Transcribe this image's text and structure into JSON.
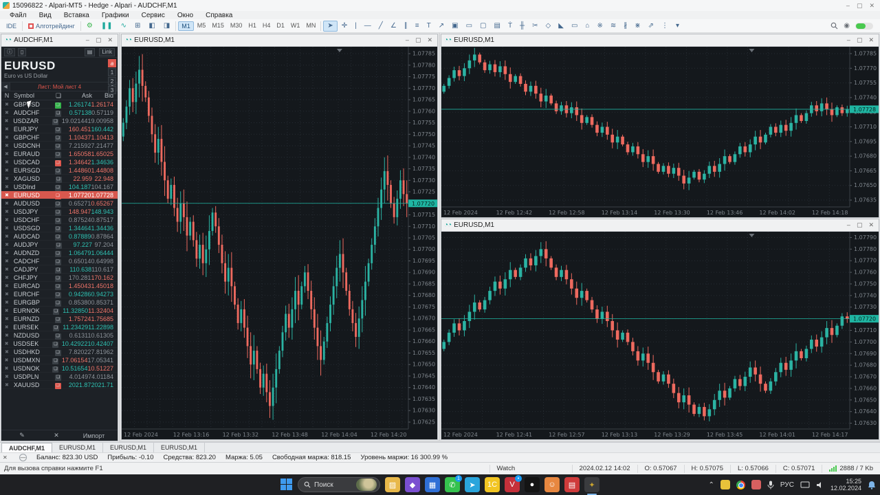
{
  "colors": {
    "candle_up": "#2bb3a3",
    "candle_down": "#ee6a5f",
    "price_tag_bg": "#1fb5a2",
    "selected_row": "#d8584e",
    "chart_bg": "#14181c",
    "grid": "#262c33",
    "axis_text": "#7f868d"
  },
  "app": {
    "title": "15096822 - Alpari-MT5 - Hedge - Alpari - AUDCHF,M1",
    "menus": [
      "Файл",
      "Вид",
      "Вставка",
      "Графики",
      "Сервис",
      "Окно",
      "Справка"
    ],
    "window_buttons": [
      "–",
      "▢",
      "✕"
    ]
  },
  "toolbar": {
    "ide_label": "IDE",
    "algo_label": "Алготрейдинг",
    "left_icons": [
      {
        "name": "gear-icon",
        "glyph": "⚙",
        "color": "#35b44a"
      },
      {
        "name": "pause-tester-icon",
        "glyph": "❚❚",
        "color": "#1fa99d"
      },
      {
        "name": "zigzag-icon",
        "glyph": "∿",
        "color": "#1fa99d"
      },
      {
        "name": "grid-window-icon",
        "glyph": "⊞",
        "color": "#44688e"
      },
      {
        "name": "expand-horizontal-icon",
        "glyph": "◧",
        "color": "#44688e"
      },
      {
        "name": "collapse-horizontal-icon",
        "glyph": "◨",
        "color": "#44688e"
      }
    ],
    "timeframes": [
      {
        "label": "M1",
        "active": true
      },
      {
        "label": "M5",
        "active": false
      },
      {
        "label": "M15",
        "active": false
      },
      {
        "label": "M30",
        "active": false
      },
      {
        "label": "H1",
        "active": false
      },
      {
        "label": "H4",
        "active": false
      },
      {
        "label": "D1",
        "active": false
      },
      {
        "label": "W1",
        "active": false
      },
      {
        "label": "MN",
        "active": false
      }
    ],
    "draw_icons": [
      {
        "name": "cursor-icon",
        "glyph": "➤",
        "active": true
      },
      {
        "name": "crosshair-icon",
        "glyph": "✛",
        "active": false
      },
      {
        "name": "vertical-line-icon",
        "glyph": "|",
        "active": false
      },
      {
        "name": "horizontal-line-icon",
        "glyph": "―",
        "active": false
      },
      {
        "name": "trendline-icon",
        "glyph": "╱",
        "active": false
      },
      {
        "name": "trend-angle-icon",
        "glyph": "∠",
        "active": false
      },
      {
        "name": "channel-icon",
        "glyph": "∥",
        "active": false
      },
      {
        "name": "equidistant-channel-icon",
        "glyph": "≡",
        "active": false
      },
      {
        "name": "text-label-icon",
        "glyph": "T",
        "active": false
      },
      {
        "name": "arrow-icon",
        "glyph": "↗",
        "active": false
      },
      {
        "name": "chart-object-icon",
        "glyph": "▣",
        "active": false
      },
      {
        "name": "label-object-icon",
        "glyph": "▭",
        "active": false
      },
      {
        "name": "button-object-icon",
        "glyph": "▢",
        "active": false
      },
      {
        "name": "image-object-icon",
        "glyph": "▤",
        "active": false
      },
      {
        "name": "styles-icon",
        "glyph": "Ṫ",
        "active": false
      },
      {
        "name": "volumes-icon",
        "glyph": "╫",
        "active": false
      },
      {
        "name": "scissors-icon",
        "glyph": "✂",
        "active": false
      },
      {
        "name": "ellipse-icon",
        "glyph": "◇",
        "active": false
      },
      {
        "name": "triangle-icon",
        "glyph": "◣",
        "active": false
      },
      {
        "name": "rectangle-icon",
        "glyph": "▭",
        "active": false
      },
      {
        "name": "shapes-icon",
        "glyph": "⌂",
        "active": false
      },
      {
        "name": "fibo-fan-icon",
        "glyph": "※",
        "active": false
      },
      {
        "name": "fibo-arcs-icon",
        "glyph": "≋",
        "active": false
      },
      {
        "name": "fibo-channel-icon",
        "glyph": "∦",
        "active": false
      },
      {
        "name": "gann-icon",
        "glyph": "⋇",
        "active": false
      },
      {
        "name": "andrews-pitchfork-icon",
        "glyph": "⇗",
        "active": false
      },
      {
        "name": "cycles-icon",
        "glyph": "⋮",
        "active": false
      },
      {
        "name": "objects-list-icon",
        "glyph": "▾",
        "active": false
      }
    ]
  },
  "market_watch": {
    "window_title": "AUDCHF,M1",
    "tools": {
      "info": "ⓘ",
      "mobile": "▯",
      "pin": "▤",
      "link_label": "Link"
    },
    "symbol_name": "EURUSD",
    "symbol_desc": "Euro vs US Dollar",
    "depth_buttons": [
      "a",
      "1",
      "2",
      "3"
    ],
    "sheet_label": "Лист: Мой лист 4",
    "columns": {
      "n": "N",
      "symbol": "Symbol",
      "chart": "❏",
      "ask": "Ask",
      "bid": "Bid"
    },
    "footer": {
      "edit": "✎",
      "close": "✕",
      "import_label": "Импорт"
    },
    "rows": [
      {
        "symbol": "GBPUSD",
        "badge": "g",
        "ask": "1.26174",
        "ac": "up",
        "bid": "1.26174",
        "bc": "down"
      },
      {
        "symbol": "AUDCHF",
        "badge": "",
        "ask": "0.57138",
        "ac": "up",
        "bid": "0.57119",
        "bc": "flat"
      },
      {
        "symbol": "USDZAR",
        "badge": "",
        "ask": "19.02144",
        "ac": "flat",
        "bid": "19.00958",
        "bc": "flat"
      },
      {
        "symbol": "EURJPY",
        "badge": "",
        "ask": "160.451",
        "ac": "down",
        "bid": "160.442",
        "bc": "up"
      },
      {
        "symbol": "GBPCHF",
        "badge": "",
        "ask": "1.10437",
        "ac": "down",
        "bid": "1.10413",
        "bc": "down"
      },
      {
        "symbol": "USDCNH",
        "badge": "",
        "ask": "7.21592",
        "ac": "flat",
        "bid": "7.21477",
        "bc": "flat"
      },
      {
        "symbol": "EURAUD",
        "badge": "",
        "ask": "1.65058",
        "ac": "down",
        "bid": "1.65025",
        "bc": "down"
      },
      {
        "symbol": "USDCAD",
        "badge": "r",
        "ask": "1.34642",
        "ac": "down",
        "bid": "1.34636",
        "bc": "up"
      },
      {
        "symbol": "EURSGD",
        "badge": "",
        "ask": "1.44860",
        "ac": "down",
        "bid": "1.44808",
        "bc": "down"
      },
      {
        "symbol": "XAGUSD",
        "badge": "",
        "ask": "22.959",
        "ac": "down",
        "bid": "22.948",
        "bc": "down"
      },
      {
        "symbol": "USDInd",
        "badge": "",
        "ask": "104.187",
        "ac": "up",
        "bid": "104.167",
        "bc": "flat"
      },
      {
        "symbol": "EURUSD",
        "badge": "r",
        "ask": "1.07720",
        "ac": "flat",
        "bid": "1.07728",
        "bc": "down",
        "selected": true
      },
      {
        "symbol": "AUDUSD",
        "badge": "",
        "ask": "0.65271",
        "ac": "flat",
        "bid": "0.65267",
        "bc": "down"
      },
      {
        "symbol": "USDJPY",
        "badge": "",
        "ask": "148.947",
        "ac": "down",
        "bid": "148.943",
        "bc": "up"
      },
      {
        "symbol": "USDCHF",
        "badge": "",
        "ask": "0.87524",
        "ac": "flat",
        "bid": "0.87517",
        "bc": "flat"
      },
      {
        "symbol": "USDSGD",
        "badge": "",
        "ask": "1.34464",
        "ac": "up",
        "bid": "1.34436",
        "bc": "up"
      },
      {
        "symbol": "AUDCAD",
        "badge": "",
        "ask": "0.87889",
        "ac": "up",
        "bid": "0.87864",
        "bc": "flat"
      },
      {
        "symbol": "AUDJPY",
        "badge": "",
        "ask": "97.227",
        "ac": "up",
        "bid": "97.204",
        "bc": "flat"
      },
      {
        "symbol": "AUDNZD",
        "badge": "",
        "ask": "1.06479",
        "ac": "up",
        "bid": "1.06444",
        "bc": "up"
      },
      {
        "symbol": "CADCHF",
        "badge": "",
        "ask": "0.65014",
        "ac": "flat",
        "bid": "0.64998",
        "bc": "flat"
      },
      {
        "symbol": "CADJPY",
        "badge": "",
        "ask": "110.638",
        "ac": "up",
        "bid": "110.617",
        "bc": "flat"
      },
      {
        "symbol": "CHFJPY",
        "badge": "",
        "ask": "170.281",
        "ac": "flat",
        "bid": "170.162",
        "bc": "down"
      },
      {
        "symbol": "EURCAD",
        "badge": "",
        "ask": "1.45043",
        "ac": "down",
        "bid": "1.45018",
        "bc": "down"
      },
      {
        "symbol": "EURCHF",
        "badge": "",
        "ask": "0.94286",
        "ac": "up",
        "bid": "0.94273",
        "bc": "up"
      },
      {
        "symbol": "EURGBP",
        "badge": "",
        "ask": "0.85380",
        "ac": "flat",
        "bid": "0.85371",
        "bc": "flat"
      },
      {
        "symbol": "EURNOK",
        "badge": "",
        "ask": "11.32850",
        "ac": "up",
        "bid": "11.32404",
        "bc": "down"
      },
      {
        "symbol": "EURNZD",
        "badge": "",
        "ask": "1.75724",
        "ac": "down",
        "bid": "1.75685",
        "bc": "down"
      },
      {
        "symbol": "EURSEK",
        "badge": "",
        "ask": "11.23429",
        "ac": "up",
        "bid": "11.22898",
        "bc": "up"
      },
      {
        "symbol": "NZDUSD",
        "badge": "",
        "ask": "0.61311",
        "ac": "flat",
        "bid": "0.61305",
        "bc": "flat"
      },
      {
        "symbol": "USDSEK",
        "badge": "",
        "ask": "10.42922",
        "ac": "up",
        "bid": "10.42407",
        "bc": "up"
      },
      {
        "symbol": "USDHKD",
        "badge": "",
        "ask": "7.82022",
        "ac": "flat",
        "bid": "7.81962",
        "bc": "flat"
      },
      {
        "symbol": "USDMXN",
        "badge": "",
        "ask": "17.06154",
        "ac": "down",
        "bid": "17.05341",
        "bc": "flat"
      },
      {
        "symbol": "USDNOK",
        "badge": "",
        "ask": "10.51654",
        "ac": "up",
        "bid": "10.51227",
        "bc": "down"
      },
      {
        "symbol": "USDPLN",
        "badge": "",
        "ask": "4.01497",
        "ac": "flat",
        "bid": "4.01184",
        "bc": "flat"
      },
      {
        "symbol": "XAUUSD",
        "badge": "r",
        "ask": "2021.87",
        "ac": "up",
        "bid": "2021.71",
        "bc": "up"
      }
    ]
  },
  "chart_data": [
    {
      "type": "candlestick",
      "title": "EURUSD,M1",
      "ylim": [
        1.07622,
        1.07788
      ],
      "current_price": 1.0772,
      "price_ticks": [
        "1.07785",
        "1.07780",
        "1.07775",
        "1.07770",
        "1.07765",
        "1.07760",
        "1.07755",
        "1.07750",
        "1.07745",
        "1.07740",
        "1.07735",
        "1.07730",
        "1.07725",
        "1.07720",
        "1.07715",
        "1.07710",
        "1.07705",
        "1.07700",
        "1.07695",
        "1.07690",
        "1.07685",
        "1.07680",
        "1.07675",
        "1.07670",
        "1.07665",
        "1.07660",
        "1.07655",
        "1.07650",
        "1.07645",
        "1.07640",
        "1.07635",
        "1.07630",
        "1.07625"
      ],
      "time_labels": [
        "12 Feb 2024",
        "12 Feb 13:16",
        "12 Feb 13:32",
        "12 Feb 13:48",
        "12 Feb 14:04",
        "12 Feb 14:20"
      ],
      "closes": [
        1.07755,
        1.07762,
        1.0777,
        1.07764,
        1.07772,
        1.07778,
        1.07771,
        1.07766,
        1.07758,
        1.0775,
        1.07742,
        1.07748,
        1.07738,
        1.0773,
        1.07722,
        1.07728,
        1.07718,
        1.07712,
        1.0772,
        1.07714,
        1.07706,
        1.07712,
        1.07704,
        1.07696,
        1.07702,
        1.07694,
        1.077,
        1.07708,
        1.07716,
        1.0771,
        1.07702,
        1.07694,
        1.07686,
        1.07692,
        1.07684,
        1.07676,
        1.07668,
        1.07674,
        1.07666,
        1.07658,
        1.0765,
        1.07656,
        1.07648,
        1.0764,
        1.07646,
        1.07638,
        1.07632,
        1.0764,
        1.07648,
        1.07656,
        1.07664,
        1.07672,
        1.07666,
        1.07674,
        1.07682,
        1.07676,
        1.07684,
        1.0769,
        1.07682,
        1.07674,
        1.07666,
        1.07658,
        1.07652,
        1.0766,
        1.07668,
        1.07676,
        1.07684,
        1.07692,
        1.07698,
        1.0769,
        1.07682,
        1.07674,
        1.07668,
        1.07662,
        1.0767,
        1.07678,
        1.07686,
        1.07694,
        1.07702,
        1.0771,
        1.07718,
        1.07726,
        1.07734,
        1.07728,
        1.0772,
        1.07714,
        1.07722,
        1.0773,
        1.07724,
        1.0772
      ]
    },
    {
      "type": "candlestick",
      "title": "EURUSD,M1",
      "ylim": [
        1.07628,
        1.07792
      ],
      "current_price": 1.07728,
      "price_ticks": [
        "1.07785",
        "1.07770",
        "1.07755",
        "1.07740",
        "1.07725",
        "1.07710",
        "1.07695",
        "1.07680",
        "1.07665",
        "1.07650",
        "1.07635"
      ],
      "time_labels": [
        "12 Feb 2024",
        "12 Feb 12:42",
        "12 Feb 12:58",
        "12 Feb 13:14",
        "12 Feb 13:30",
        "12 Feb 13:46",
        "12 Feb 14:02",
        "12 Feb 14:18"
      ],
      "closes": [
        1.07752,
        1.0776,
        1.07768,
        1.07762,
        1.0777,
        1.07778,
        1.07784,
        1.07776,
        1.07768,
        1.07774,
        1.07766,
        1.07772,
        1.07764,
        1.07756,
        1.07762,
        1.07754,
        1.07746,
        1.07752,
        1.07744,
        1.07736,
        1.07742,
        1.07734,
        1.07726,
        1.07732,
        1.07724,
        1.0773,
        1.07722,
        1.07714,
        1.0772,
        1.07712,
        1.07704,
        1.0771,
        1.07702,
        1.07694,
        1.077,
        1.07692,
        1.07684,
        1.0769,
        1.07682,
        1.07674,
        1.0768,
        1.07672,
        1.07664,
        1.0767,
        1.07662,
        1.07668,
        1.0766,
        1.07652,
        1.07658,
        1.07664,
        1.07656,
        1.07662,
        1.0767,
        1.07664,
        1.07672,
        1.0768,
        1.07674,
        1.07682,
        1.0769,
        1.07684,
        1.07692,
        1.077,
        1.07694,
        1.07702,
        1.0771,
        1.07704,
        1.07712,
        1.07706,
        1.07714,
        1.07722,
        1.07716,
        1.07724,
        1.07732,
        1.07726,
        1.07734,
        1.07728,
        1.07722,
        1.0773,
        1.07724,
        1.07728
      ]
    },
    {
      "type": "candlestick",
      "title": "EURUSD,M1",
      "ylim": [
        1.07625,
        1.07795
      ],
      "current_price": 1.0772,
      "price_ticks": [
        "1.07790",
        "1.07780",
        "1.07770",
        "1.07760",
        "1.07750",
        "1.07740",
        "1.07730",
        "1.07720",
        "1.07710",
        "1.07700",
        "1.07690",
        "1.07680",
        "1.07670",
        "1.07660",
        "1.07650",
        "1.07640",
        "1.07630"
      ],
      "time_labels": [
        "12 Feb 2024",
        "12 Feb 12:41",
        "12 Feb 12:57",
        "12 Feb 13:13",
        "12 Feb 13:29",
        "12 Feb 13:45",
        "12 Feb 14:01",
        "12 Feb 14:17"
      ],
      "closes": [
        1.077,
        1.07708,
        1.07716,
        1.0771,
        1.07718,
        1.07726,
        1.07734,
        1.07728,
        1.07736,
        1.07744,
        1.07752,
        1.07746,
        1.07754,
        1.07762,
        1.07756,
        1.07764,
        1.07772,
        1.07766,
        1.07774,
        1.0778,
        1.07772,
        1.07764,
        1.07756,
        1.07762,
        1.07754,
        1.07746,
        1.07738,
        1.07744,
        1.07736,
        1.07728,
        1.0772,
        1.07726,
        1.07718,
        1.0771,
        1.07702,
        1.07708,
        1.077,
        1.07692,
        1.07684,
        1.0769,
        1.07682,
        1.07674,
        1.07666,
        1.07672,
        1.07664,
        1.07656,
        1.07648,
        1.07654,
        1.07646,
        1.07638,
        1.07644,
        1.07636,
        1.07642,
        1.0765,
        1.07658,
        1.07652,
        1.0766,
        1.07668,
        1.07662,
        1.0767,
        1.07678,
        1.07672,
        1.07664,
        1.07658,
        1.07666,
        1.07674,
        1.07682,
        1.07676,
        1.07684,
        1.07692,
        1.07686,
        1.07694,
        1.07702,
        1.07696,
        1.07704,
        1.07712,
        1.07706,
        1.07714,
        1.07722,
        1.0772
      ]
    }
  ],
  "bottom": {
    "tabs": [
      {
        "label": "AUDCHF,M1",
        "active": true
      },
      {
        "label": "EURUSD,M1",
        "active": false
      },
      {
        "label": "EURUSD,M1",
        "active": false
      },
      {
        "label": "EURUSD,M1",
        "active": false
      }
    ],
    "balance_items": [
      "Баланс: 823.30 USD",
      "Прибыль: -0.10",
      "Средства: 823.20",
      "Маржа: 5.05",
      "Свободная маржа: 818.15",
      "Уровень маржи: 16 300.99 %"
    ],
    "help_text": "Для вызова справки нажмите F1",
    "watch_label": "Watch",
    "datetime": "2024.02.12 14:02",
    "ohlc": [
      "O: 0.57067",
      "H: 0.57075",
      "L: 0.57066",
      "C: 0.57071"
    ],
    "traffic": "2888 / 7 Kb"
  },
  "taskbar": {
    "search_placeholder": "Поиск",
    "apps": [
      {
        "name": "file-explorer-icon",
        "glyph": "▨",
        "bg": "#e8b84a",
        "badge": ""
      },
      {
        "name": "purple-app-icon",
        "glyph": "◆",
        "bg": "#7a4fd0",
        "badge": ""
      },
      {
        "name": "metatrader-icon",
        "glyph": "▦",
        "bg": "#2f6fd6",
        "badge": ""
      },
      {
        "name": "whatsapp-icon",
        "glyph": "✆",
        "bg": "#35c24e",
        "badge": "1"
      },
      {
        "name": "telegram-icon",
        "glyph": "➤",
        "bg": "#2aa5dc",
        "badge": ""
      },
      {
        "name": "1c-app-icon",
        "glyph": "1С",
        "bg": "#f2c522",
        "badge": ""
      },
      {
        "name": "vivaldi-icon",
        "glyph": "V",
        "bg": "#c5303a",
        "badge": "•"
      },
      {
        "name": "black-dot-app-icon",
        "glyph": "●",
        "bg": "#141414",
        "badge": ""
      },
      {
        "name": "people-app-icon",
        "glyph": "☺",
        "bg": "#e78740",
        "badge": ""
      },
      {
        "name": "red-app-icon",
        "glyph": "▤",
        "bg": "#cf3b3b",
        "badge": ""
      },
      {
        "name": "gold-active-app-icon",
        "glyph": "✦",
        "bg": "#caa42e",
        "badge": "",
        "active": true
      }
    ],
    "language": "РУС",
    "time": "15:25",
    "date": "12.02.2024"
  }
}
